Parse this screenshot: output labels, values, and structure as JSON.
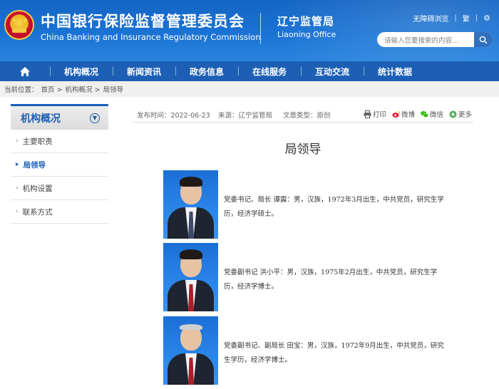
{
  "header": {
    "title_cn": "中国银行保险监督管理委员会",
    "title_en": "China Banking and Insurance Regulatory Commission",
    "office_cn": "辽宁监管局",
    "office_en": "Liaoning Office",
    "accessibility": "无障碍浏览",
    "traditional": "繁",
    "search_placeholder": "请输入您要搜索的内容..."
  },
  "nav": {
    "items": [
      "机构概况",
      "新闻资讯",
      "政务信息",
      "在线服务",
      "互动交流",
      "统计数据"
    ]
  },
  "breadcrumb": {
    "prefix": "当前位置：",
    "items": [
      "首页 >",
      "机构概况 >",
      "局领导"
    ]
  },
  "sidebar": {
    "title": "机构概况",
    "items": [
      {
        "label": "主要职责"
      },
      {
        "label": "局领导"
      },
      {
        "label": "机构设置"
      },
      {
        "label": "联系方式"
      }
    ]
  },
  "article": {
    "publish_time": "发布时间：2022-06-23",
    "source": "来源：辽宁监管局",
    "type": "文章类型：原创",
    "share": {
      "print": "打印",
      "weibo": "微博",
      "wechat": "微信",
      "more": "更多"
    },
    "title": "局领导",
    "leaders": [
      {
        "desc": "党委书记、局长 谭震：男，汉族，1972年3月出生，中共党员，研究生学历，经济学硕士。"
      },
      {
        "desc": "党委副书记 洪小平：男，汉族，1975年2月出生，中共党员，研究生学历，经济学博士。"
      },
      {
        "desc": "党委副书记、副局长 田宝：男，汉族，1972年9月出生，中共党员，研究生学历，经济学博士。"
      }
    ]
  },
  "colors": {
    "primary": "#1c5fb5",
    "header": "#1a73d4",
    "active": "#1c5fb5"
  }
}
